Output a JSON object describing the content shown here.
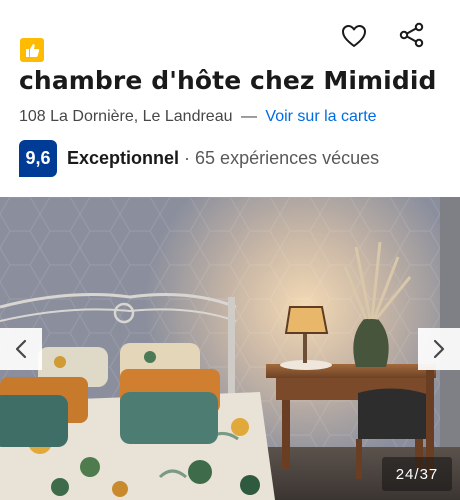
{
  "property": {
    "badge_icon": "thumbs-up-icon",
    "title": "chambre d'hôte chez Mimidid",
    "address": "108 La Dornière, Le Landreau",
    "separator": "—",
    "map_link": "Voir sur la carte"
  },
  "actions": {
    "favorite_icon": "heart-outline-icon",
    "share_icon": "share-icon"
  },
  "rating": {
    "score": "9,6",
    "label": "Exceptionnel",
    "separator": "·",
    "reviews": "65 expériences vécues"
  },
  "gallery": {
    "counter": "24/37",
    "prev_icon": "chevron-left-icon",
    "next_icon": "chevron-right-icon"
  },
  "colors": {
    "brand_blue": "#003b95",
    "link_blue": "#006ce4",
    "badge_yellow": "#febb02"
  }
}
